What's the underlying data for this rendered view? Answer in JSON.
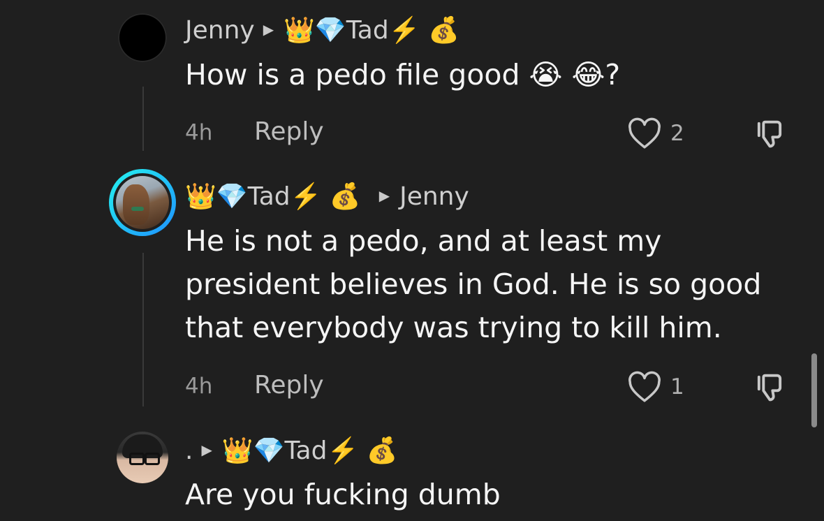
{
  "comments": [
    {
      "author": "Jenny",
      "reply_to_prefix": "👑💎",
      "reply_to_name": "Tad",
      "reply_to_suffix": "⚡️ 💰",
      "text_lines": [
        "How is a pedo file good 😭 😂?"
      ],
      "time": "4h",
      "reply_label": "Reply",
      "likes": "2"
    },
    {
      "author_prefix": "👑💎",
      "author_name": "Tad",
      "author_suffix": "⚡️ 💰",
      "reply_to": "Jenny",
      "text_lines": [
        "He is not a pedo, and at least my",
        "president believes in God. He is so good",
        "that everybody was trying to kill him."
      ],
      "time": "4h",
      "reply_label": "Reply",
      "likes": "1"
    },
    {
      "author": ".",
      "reply_to_prefix": "👑💎",
      "reply_to_name": "Tad",
      "reply_to_suffix": "⚡️ 💰",
      "text_lines": [
        "Are you fucking dumb"
      ]
    }
  ],
  "colors": {
    "background": "#1f1f1f",
    "text": "#f5f5f5",
    "muted": "#9a9a9a",
    "ring_gradient": [
      "#25f4ee",
      "#1e90ff"
    ]
  },
  "icons": {
    "like": "heart-outline-icon",
    "dislike": "thumbs-down-icon",
    "arrow": "triangle-right-icon"
  }
}
